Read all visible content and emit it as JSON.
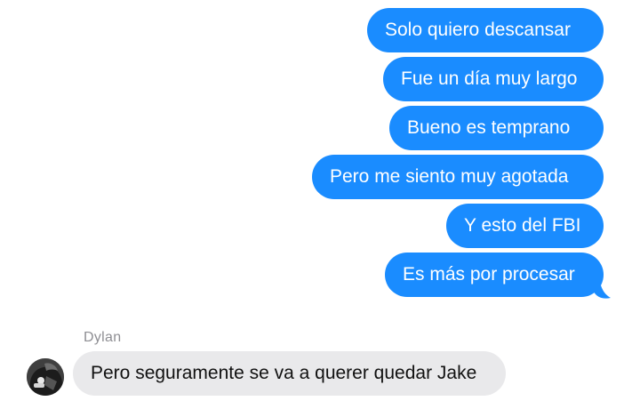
{
  "conversation": {
    "outgoing": [
      {
        "text": "Solo quiero descansar"
      },
      {
        "text": "Fue un día muy largo"
      },
      {
        "text": "Bueno es temprano"
      },
      {
        "text": "Pero me siento muy agotada"
      },
      {
        "text": "Y esto del FBI"
      },
      {
        "text": "Es más por procesar"
      }
    ],
    "incoming": {
      "sender": "Dylan",
      "text": "Pero seguramente se va a querer quedar Jake"
    }
  },
  "colors": {
    "sent_bubble": "#1a8cff",
    "received_bubble": "#e9e9eb",
    "sender_name": "#8e8e93"
  },
  "icons": {
    "avatar": "user-avatar-photo"
  }
}
